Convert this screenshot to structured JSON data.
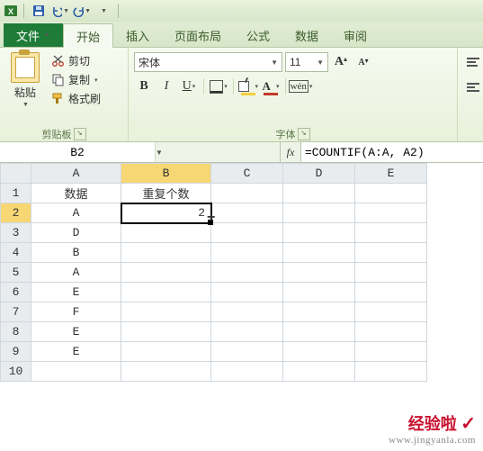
{
  "qat": {
    "save": "保存",
    "undo": "撤销",
    "redo": "重做"
  },
  "tabs": {
    "file": "文件",
    "home": "开始",
    "insert": "插入",
    "layout": "页面布局",
    "formulas": "公式",
    "data": "数据",
    "review": "审阅"
  },
  "clipboard": {
    "paste": "粘贴",
    "cut": "剪切",
    "copy": "复制",
    "format_painter": "格式刷",
    "group": "剪贴板"
  },
  "font": {
    "name": "宋体",
    "size": "11",
    "bold": "B",
    "italic": "I",
    "underline": "U",
    "wen": "wén",
    "font_color_letter": "A",
    "grow": "A",
    "shrink": "A",
    "group": "字体"
  },
  "namebox": "B2",
  "formula": "=COUNTIF(A:A, A2)",
  "columns": [
    "A",
    "B",
    "C",
    "D",
    "E"
  ],
  "rows": [
    "1",
    "2",
    "3",
    "4",
    "5",
    "6",
    "7",
    "8",
    "9",
    "10"
  ],
  "cells": {
    "A1": "数据",
    "B1": "重复个数",
    "A2": "A",
    "B2": "2",
    "A3": "D",
    "A4": "B",
    "A5": "A",
    "A6": "E",
    "A7": "F",
    "A8": "E",
    "A9": "E"
  },
  "watermark": {
    "line1": "经验啦",
    "check": "✓",
    "line2": "www.jingyanla.com"
  }
}
